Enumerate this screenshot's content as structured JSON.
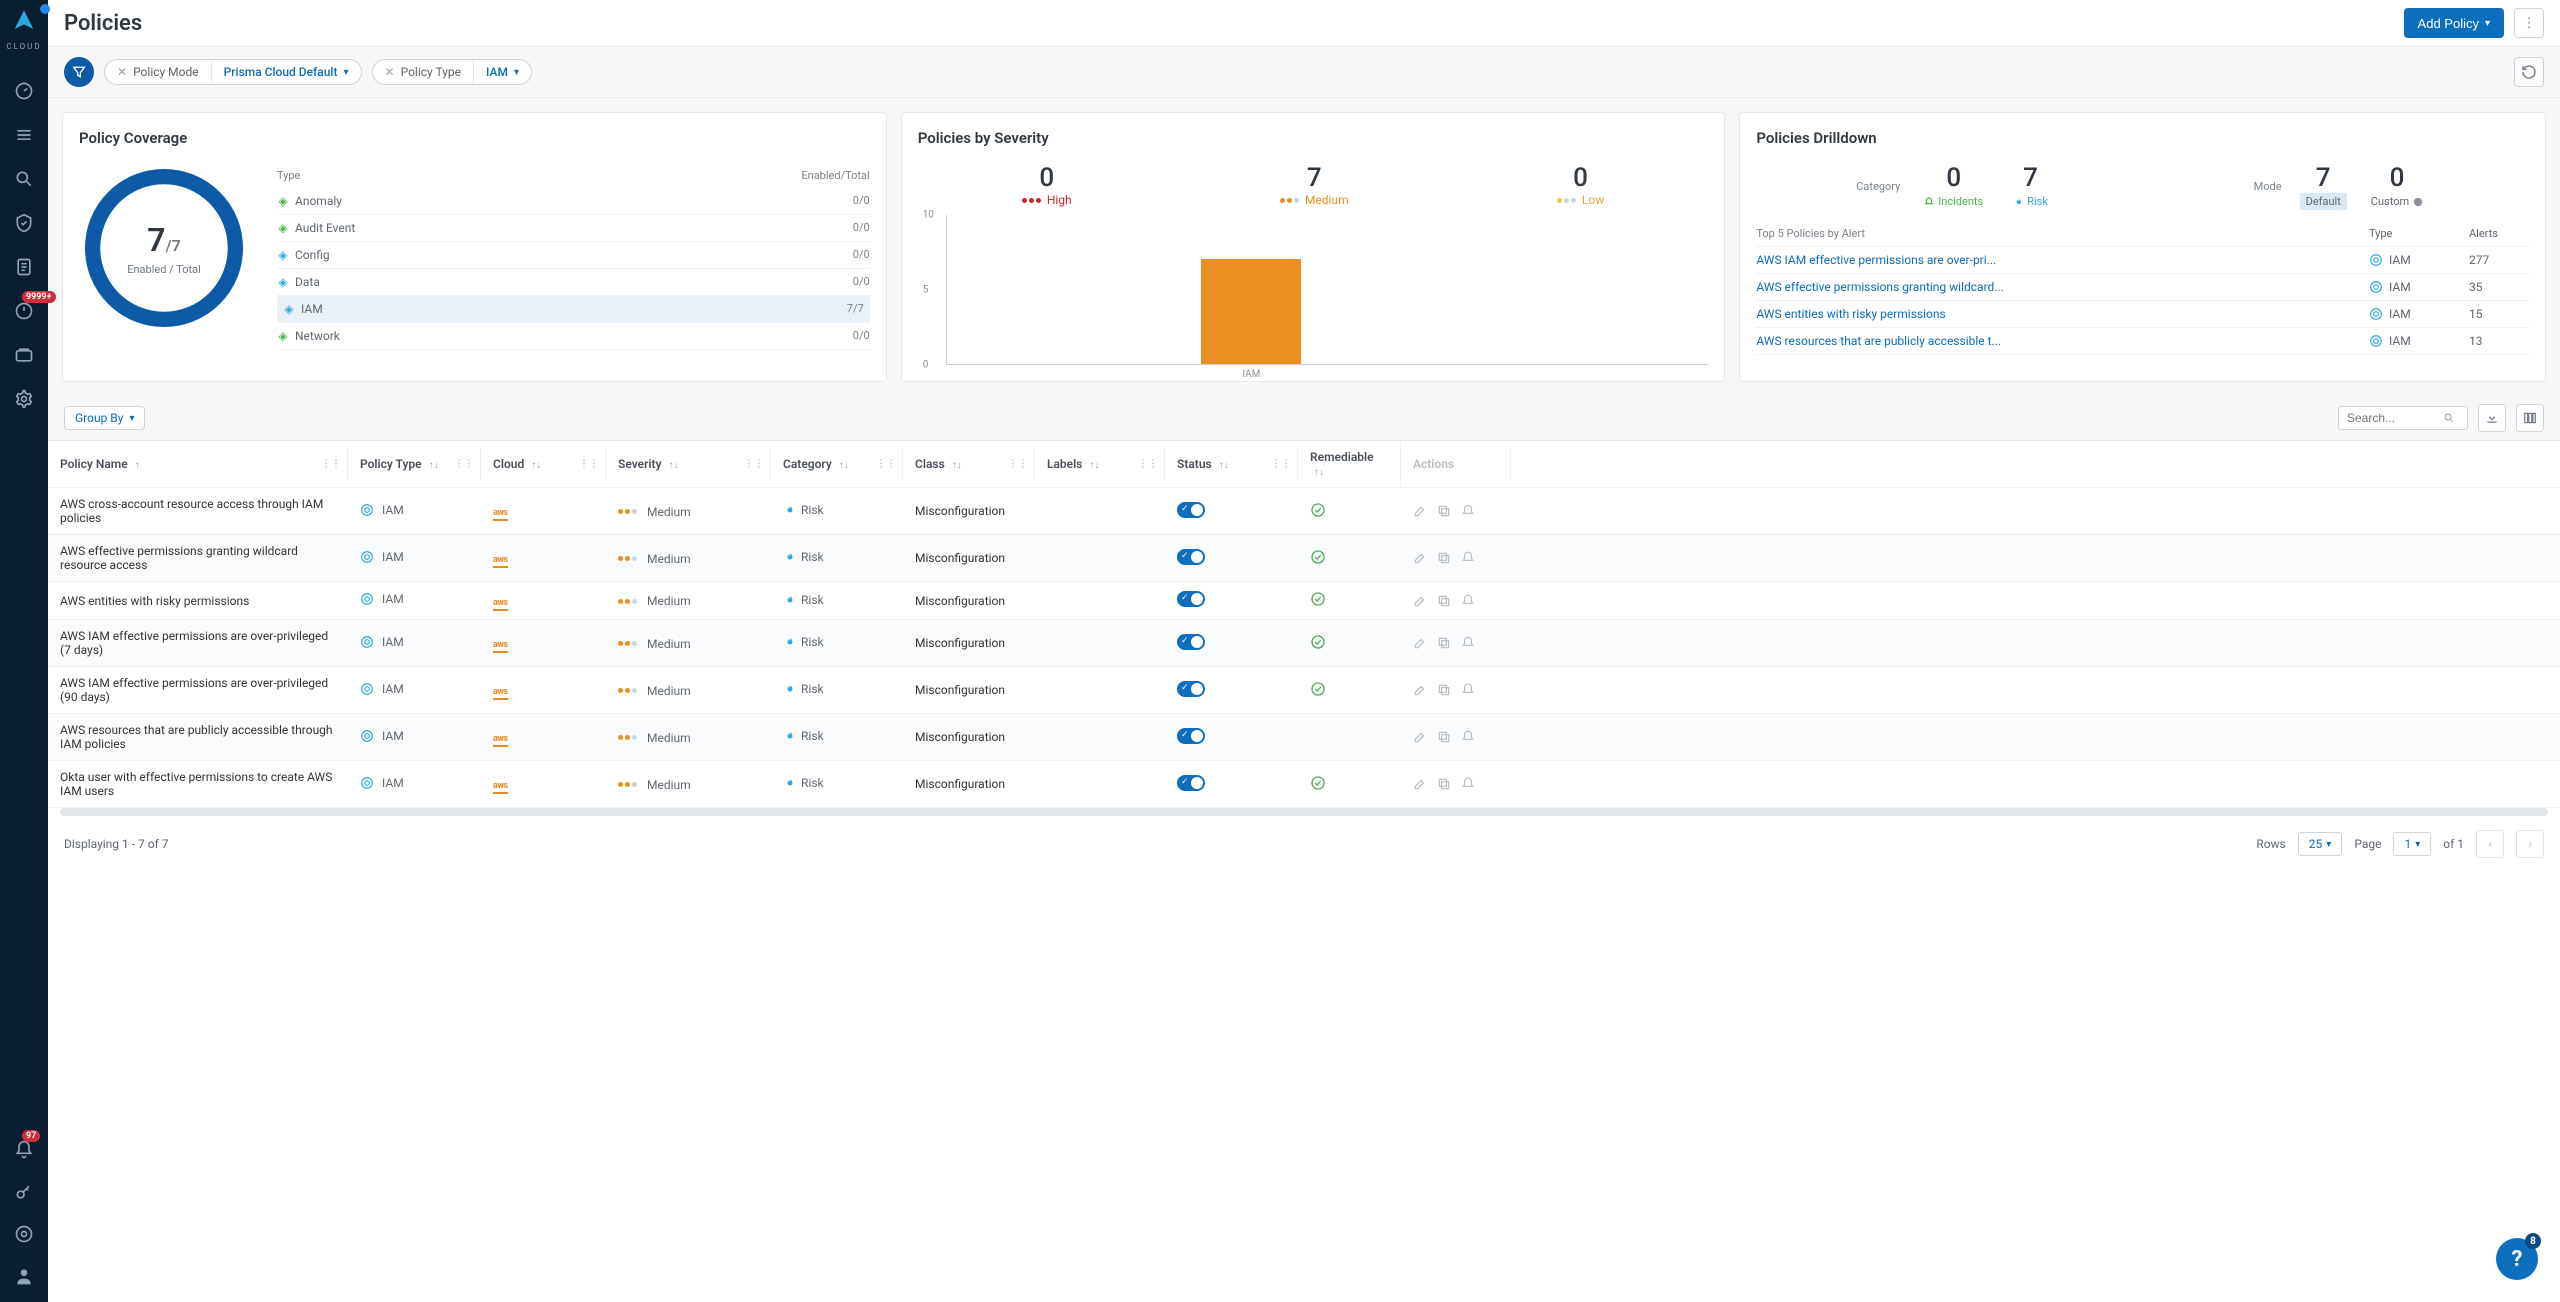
{
  "page_title": "Policies",
  "header": {
    "add_policy": "Add Policy"
  },
  "filters": {
    "mode_label": "Policy Mode",
    "mode_value": "Prisma Cloud Default",
    "type_label": "Policy Type",
    "type_value": "IAM"
  },
  "sidebar_alert_badge": "9999+",
  "sidebar_bell_badge": "97",
  "help_badge": "8",
  "coverage": {
    "title": "Policy Coverage",
    "enabled": "7",
    "total": "/7",
    "subtitle": "Enabled / Total",
    "hdr_type": "Type",
    "hdr_enabled": "Enabled/Total",
    "rows": [
      {
        "name": "Anomaly",
        "val": "0/0",
        "color": "#4caf50"
      },
      {
        "name": "Audit Event",
        "val": "0/0",
        "color": "#4caf50"
      },
      {
        "name": "Config",
        "val": "0/0",
        "color": "#2fa7df"
      },
      {
        "name": "Data",
        "val": "0/0",
        "color": "#2fa7df"
      },
      {
        "name": "IAM",
        "val": "7/7",
        "color": "#2fa7df"
      },
      {
        "name": "Network",
        "val": "0/0",
        "color": "#4caf50"
      }
    ]
  },
  "severity": {
    "title": "Policies by Severity",
    "high": {
      "num": "0",
      "label": "High"
    },
    "medium": {
      "num": "7",
      "label": "Medium"
    },
    "low": {
      "num": "0",
      "label": "Low"
    },
    "xlabel": "IAM"
  },
  "drilldown": {
    "title": "Policies Drilldown",
    "cat_label": "Category",
    "mode_label": "Mode",
    "incidents": {
      "num": "0",
      "label": "Incidents"
    },
    "risk": {
      "num": "7",
      "label": "Risk"
    },
    "default": {
      "num": "7",
      "label": "Default"
    },
    "custom": {
      "num": "0",
      "label": "Custom"
    },
    "tbl_hdr": "Top 5 Policies by Alert",
    "tbl_type": "Type",
    "tbl_alerts": "Alerts",
    "rows": [
      {
        "name": "AWS IAM effective permissions are over-pri...",
        "type": "IAM",
        "alerts": "277"
      },
      {
        "name": "AWS effective permissions granting wildcard...",
        "type": "IAM",
        "alerts": "35"
      },
      {
        "name": "AWS entities with risky permissions",
        "type": "IAM",
        "alerts": "15"
      },
      {
        "name": "AWS resources that are publicly accessible t...",
        "type": "IAM",
        "alerts": "13"
      }
    ]
  },
  "group_by": "Group By",
  "search_placeholder": "Search...",
  "columns": {
    "name": "Policy Name",
    "ptype": "Policy Type",
    "cloud": "Cloud",
    "sev": "Severity",
    "cat": "Category",
    "class": "Class",
    "labels": "Labels",
    "status": "Status",
    "rem": "Remediable",
    "actions": "Actions"
  },
  "rows": [
    {
      "name": "AWS cross-account resource access through IAM policies",
      "ptype": "IAM",
      "sev": "Medium",
      "cat": "Risk",
      "class": "Misconfiguration",
      "rem": true
    },
    {
      "name": "AWS effective permissions granting wildcard resource access",
      "ptype": "IAM",
      "sev": "Medium",
      "cat": "Risk",
      "class": "Misconfiguration",
      "rem": true
    },
    {
      "name": "AWS entities with risky permissions",
      "ptype": "IAM",
      "sev": "Medium",
      "cat": "Risk",
      "class": "Misconfiguration",
      "rem": true
    },
    {
      "name": "AWS IAM effective permissions are over-privileged (7 days)",
      "ptype": "IAM",
      "sev": "Medium",
      "cat": "Risk",
      "class": "Misconfiguration",
      "rem": true
    },
    {
      "name": "AWS IAM effective permissions are over-privileged (90 days)",
      "ptype": "IAM",
      "sev": "Medium",
      "cat": "Risk",
      "class": "Misconfiguration",
      "rem": true
    },
    {
      "name": "AWS resources that are publicly accessible through IAM policies",
      "ptype": "IAM",
      "sev": "Medium",
      "cat": "Risk",
      "class": "Misconfiguration",
      "rem": false
    },
    {
      "name": "Okta user with effective permissions to create AWS IAM users",
      "ptype": "IAM",
      "sev": "Medium",
      "cat": "Risk",
      "class": "Misconfiguration",
      "rem": true
    }
  ],
  "footer": {
    "displaying": "Displaying 1 - 7 of 7",
    "rows_label": "Rows",
    "rows_value": "25",
    "page_label": "Page",
    "page_value": "1",
    "of_label": "of 1"
  },
  "chart_data": {
    "type": "bar",
    "categories": [
      "IAM"
    ],
    "values": [
      7
    ],
    "ylabel": "",
    "ylim": [
      0,
      10
    ],
    "yticks": [
      0,
      5,
      10
    ]
  }
}
